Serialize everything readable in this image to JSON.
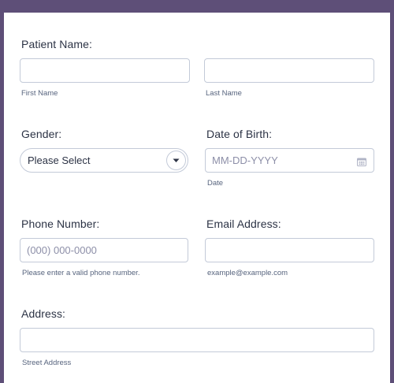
{
  "patient_name": {
    "label": "Patient Name:",
    "first_sub": "First Name",
    "last_sub": "Last Name"
  },
  "gender": {
    "label": "Gender:",
    "selected": "Please Select"
  },
  "dob": {
    "label": "Date of Birth:",
    "placeholder": "MM-DD-YYYY",
    "sub": "Date"
  },
  "phone": {
    "label": "Phone Number:",
    "placeholder": "(000) 000-0000",
    "sub": "Please enter a valid phone number."
  },
  "email": {
    "label": "Email Address:",
    "sub": "example@example.com"
  },
  "address": {
    "label": "Address:",
    "sub": "Street Address"
  },
  "colors": {
    "background": "#5e4f78",
    "card": "#ffffff",
    "border": "#c3cad8",
    "text": "#2c3345"
  }
}
